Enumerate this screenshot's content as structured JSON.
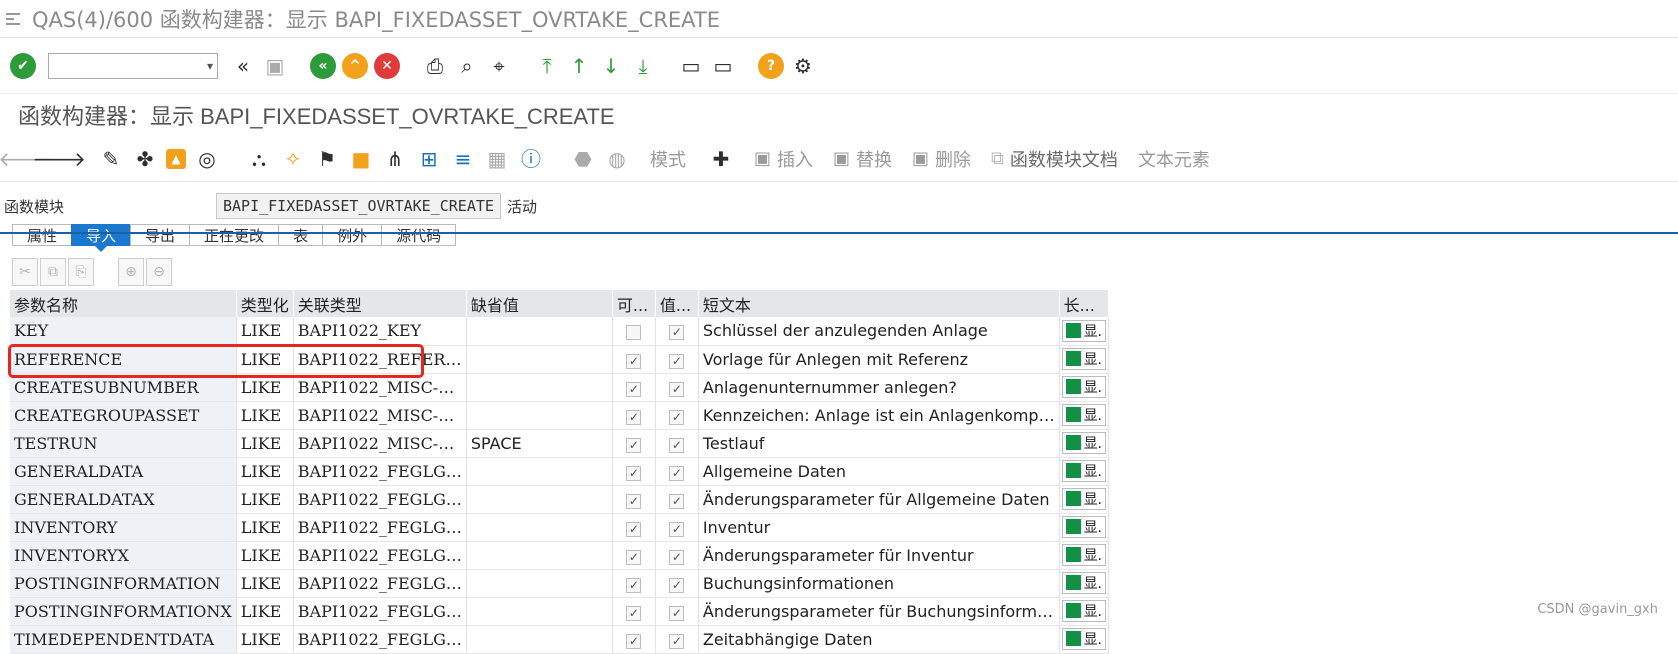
{
  "window": {
    "title": "QAS(4)/600 函数构建器：显示 BAPI_FIXEDASSET_OVRTAKE_CREATE"
  },
  "screen_title": "函数构建器：显示 BAPI_FIXEDASSET_OVRTAKE_CREATE",
  "app_toolbar": {
    "mode_label": "模式",
    "insert_label": "插入",
    "replace_label": "替换",
    "delete_label": "删除",
    "fm_doc_label": "函数模块文档",
    "text_elements_label": "文本元素"
  },
  "function_module": {
    "label": "函数模块",
    "value": "BAPI_FIXEDASSET_OVRTAKE_CREATE",
    "status": "活动"
  },
  "tabs": [
    {
      "label": "属性"
    },
    {
      "label": "导入"
    },
    {
      "label": "导出"
    },
    {
      "label": "正在更改"
    },
    {
      "label": "表"
    },
    {
      "label": "例外"
    },
    {
      "label": "源代码"
    }
  ],
  "table": {
    "headers": {
      "param_name": "参数名称",
      "typing": "类型化",
      "assoc_type": "关联类型",
      "default": "缺省值",
      "optional": "可...",
      "pass_value": "值...",
      "short_text": "短文本",
      "long_text": "长..."
    },
    "rows": [
      {
        "name": "KEY",
        "typing": "LIKE",
        "type": "BAPI1022_KEY",
        "default": "",
        "optional": false,
        "pass_value": true,
        "text": "Schlüssel der anzulegenden Anlage",
        "long": "显."
      },
      {
        "name": "REFERENCE",
        "typing": "LIKE",
        "type": "BAPI1022_REFER…",
        "default": "",
        "optional": true,
        "pass_value": true,
        "text": "Vorlage für Anlegen mit Referenz",
        "long": "显."
      },
      {
        "name": "CREATESUBNUMBER",
        "typing": "LIKE",
        "type": "BAPI1022_MISC-…",
        "default": "",
        "optional": true,
        "pass_value": true,
        "text": "Anlagenunternummer anlegen?",
        "long": "显."
      },
      {
        "name": "CREATEGROUPASSET",
        "typing": "LIKE",
        "type": "BAPI1022_MISC-…",
        "default": "",
        "optional": true,
        "pass_value": true,
        "text": "Kennzeichen: Anlage ist ein Anlagenkomp…",
        "long": "显."
      },
      {
        "name": "TESTRUN",
        "typing": "LIKE",
        "type": "BAPI1022_MISC-…",
        "default": "SPACE",
        "optional": true,
        "pass_value": true,
        "text": "Testlauf",
        "long": "显."
      },
      {
        "name": "GENERALDATA",
        "typing": "LIKE",
        "type": "BAPI1022_FEGLG…",
        "default": "",
        "optional": true,
        "pass_value": true,
        "text": "Allgemeine Daten",
        "long": "显."
      },
      {
        "name": "GENERALDATAX",
        "typing": "LIKE",
        "type": "BAPI1022_FEGLG…",
        "default": "",
        "optional": true,
        "pass_value": true,
        "text": "Änderungsparameter für Allgemeine Daten",
        "long": "显."
      },
      {
        "name": "INVENTORY",
        "typing": "LIKE",
        "type": "BAPI1022_FEGLG…",
        "default": "",
        "optional": true,
        "pass_value": true,
        "text": "Inventur",
        "long": "显."
      },
      {
        "name": "INVENTORYX",
        "typing": "LIKE",
        "type": "BAPI1022_FEGLG…",
        "default": "",
        "optional": true,
        "pass_value": true,
        "text": "Änderungsparameter für Inventur",
        "long": "显."
      },
      {
        "name": "POSTINGINFORMATION",
        "typing": "LIKE",
        "type": "BAPI1022_FEGLG…",
        "default": "",
        "optional": true,
        "pass_value": true,
        "text": "Buchungsinformationen",
        "long": "显."
      },
      {
        "name": "POSTINGINFORMATIONX",
        "typing": "LIKE",
        "type": "BAPI1022_FEGLG…",
        "default": "",
        "optional": true,
        "pass_value": true,
        "text": "Änderungsparameter für Buchungsinform…",
        "long": "显."
      },
      {
        "name": "TIMEDEPENDENTDATA",
        "typing": "LIKE",
        "type": "BAPI1022_FEGLG…",
        "default": "",
        "optional": true,
        "pass_value": true,
        "text": "Zeitabhängige Daten",
        "long": "显."
      }
    ]
  },
  "watermark": "CSDN @gavin_gxh",
  "colors": {
    "tab_active": "#1b78d0",
    "highlight": "#e8261f",
    "long_text_indicator": "#129045"
  }
}
